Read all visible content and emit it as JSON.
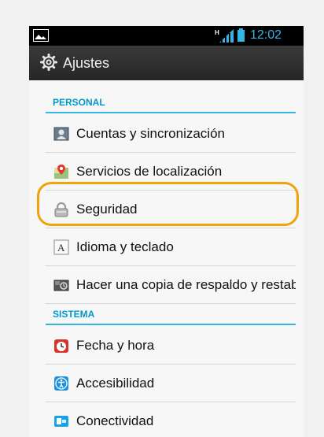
{
  "status_bar": {
    "time": "12:02",
    "network_letter": "H",
    "left_icon": "image-notification-icon",
    "accent_color": "#33b5e5"
  },
  "action_bar": {
    "title": "Ajustes",
    "icon": "gear-icon"
  },
  "sections": [
    {
      "header": "PERSONAL",
      "items": [
        {
          "label": "Cuentas y sincronización",
          "icon": "accounts-sync-icon"
        },
        {
          "label": "Servicios de localización",
          "icon": "location-icon"
        },
        {
          "label": "Seguridad",
          "icon": "security-lock-icon"
        },
        {
          "label": "Idioma y teclado",
          "icon": "language-keyboard-icon"
        },
        {
          "label": "Hacer una copia de respaldo y restablecer",
          "icon": "backup-restore-icon"
        }
      ]
    },
    {
      "header": "SISTEMA",
      "items": [
        {
          "label": "Fecha y hora",
          "icon": "clock-icon"
        },
        {
          "label": "Accesibilidad",
          "icon": "accessibility-icon"
        },
        {
          "label": "Conectividad",
          "icon": "connectivity-icon"
        }
      ]
    }
  ],
  "highlighted_item": "Seguridad",
  "highlight_color": "#f0a30a"
}
